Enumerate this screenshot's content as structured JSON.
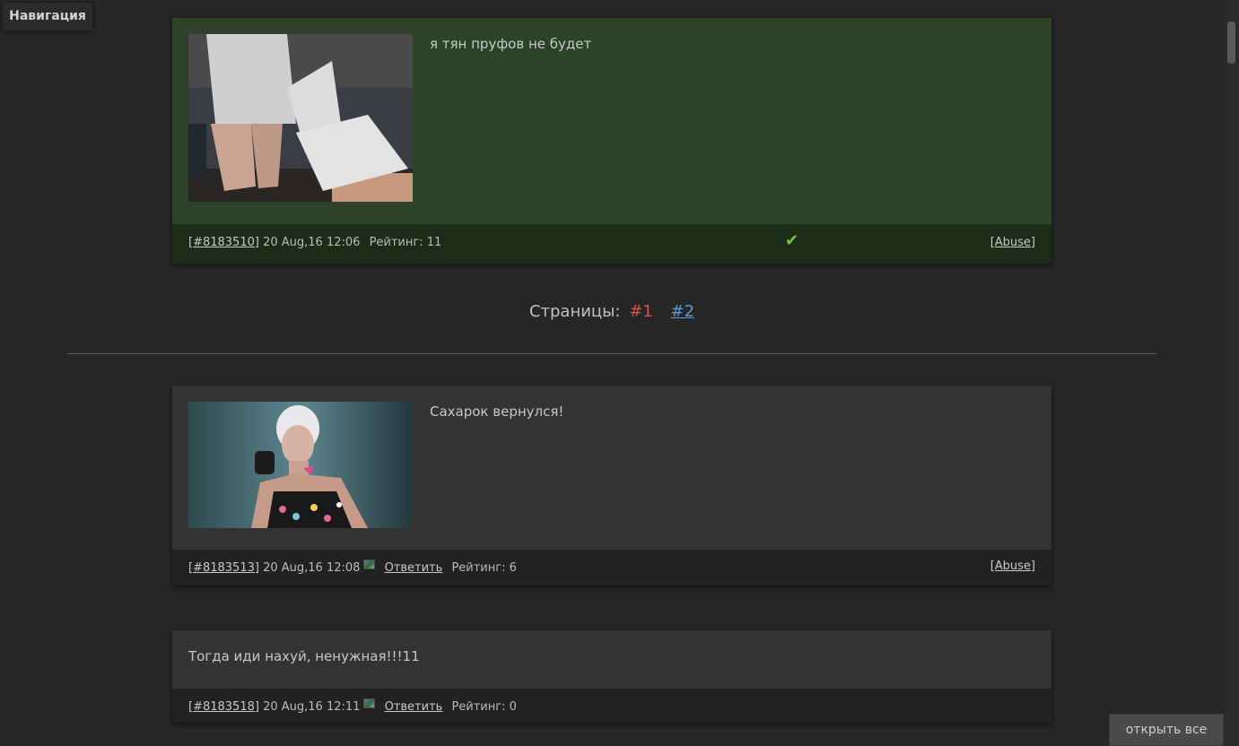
{
  "nav": {
    "label": "Навигация"
  },
  "posts": [
    {
      "text": "я тян пруфов не будет",
      "id": "[#8183510]",
      "date": "20 Aug,16 12:06",
      "rating_label": "Рейтинг: 11",
      "abuse": "[Abuse]",
      "checkmark": "✔"
    },
    {
      "text": "Сахарок вернулся!",
      "id": "[#8183513]",
      "date": "20 Aug,16 12:08",
      "reply": "Ответить",
      "rating_label": "Рейтинг: 6",
      "abuse": "[Abuse]"
    },
    {
      "text": "Тогда иди нахуй, ненужная!!!11",
      "id": "[#8183518]",
      "date": "20 Aug,16 12:11",
      "reply": "Ответить",
      "rating_label": "Рейтинг: 0"
    }
  ],
  "pagination": {
    "label": "Страницы:",
    "current": "#1",
    "next": "#2"
  },
  "open_all": "открыть все",
  "colors": {
    "background": "#262626",
    "green_post": "#2d4228",
    "grey_post": "#333333",
    "current_page": "#d95050",
    "page_link": "#5b9bd5",
    "checkmark": "#76c23e"
  }
}
